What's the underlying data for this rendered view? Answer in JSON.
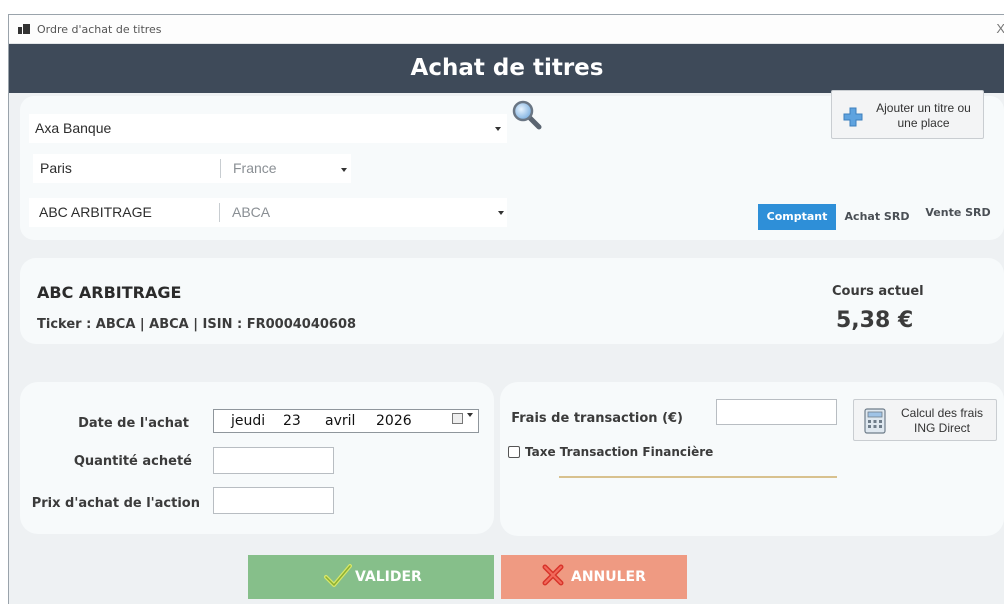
{
  "window": {
    "title": "Ordre d'achat de titres",
    "app_icon": "app-icon",
    "close_glyph": "X"
  },
  "header": {
    "title": "Achat de titres"
  },
  "selection": {
    "bank": {
      "value": "Axa Banque",
      "icon": "chevron-down-icon"
    },
    "search_icon": "search-icon",
    "place": {
      "city": "Paris",
      "country": "France"
    },
    "security": {
      "name": "ABC ARBITRAGE",
      "code": "ABCA"
    },
    "add_button": {
      "label_line1": "Ajouter un titre ou",
      "label_line2": "une place",
      "icon": "plus-icon"
    },
    "order_types": [
      {
        "label": "Comptant",
        "active": true
      },
      {
        "label": "Achat SRD",
        "active": false
      },
      {
        "label": "Vente SRD",
        "active": false
      }
    ]
  },
  "stock": {
    "name": "ABC ARBITRAGE",
    "meta": "Ticker : ABCA | ABCA | ISIN : FR0004040608",
    "price_label": "Cours actuel",
    "price_value": "5,38 €"
  },
  "purchase": {
    "date_label": "Date de l'achat",
    "date": {
      "weekday": "jeudi",
      "day": "23",
      "month": "avril",
      "year": "2026"
    },
    "quantity_label": "Quantité acheté",
    "quantity_value": "",
    "price_label": "Prix d'achat de l'action",
    "price_value": ""
  },
  "fees": {
    "label": "Frais de transaction (€)",
    "value": "",
    "calc_button_line1": "Calcul des frais",
    "calc_button_line2": "ING Direct",
    "tax_checkbox_label": "Taxe Transaction Financière",
    "tax_checked": false
  },
  "actions": {
    "validate": {
      "label": "VALIDER",
      "color": "#86bf8a",
      "icon": "check-icon"
    },
    "cancel": {
      "label": "ANNULER",
      "color": "#ef9a82",
      "icon": "cross-icon"
    }
  },
  "colors": {
    "header_bg": "#3e4a59",
    "accent": "#2e8fd8",
    "panel_bg": "#f7fafb",
    "window_bg": "#eef1f3"
  }
}
